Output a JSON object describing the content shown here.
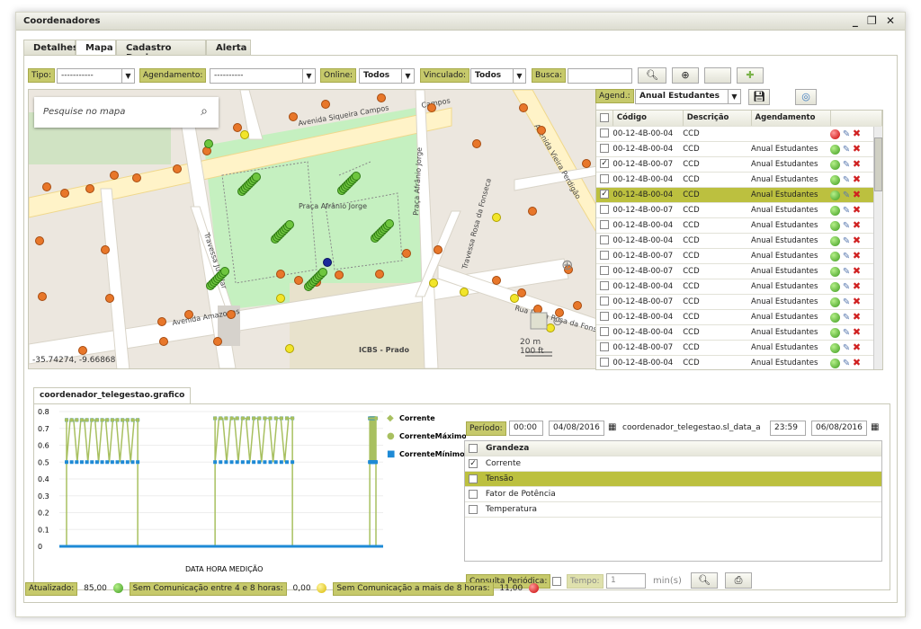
{
  "window": {
    "title": "Coordenadores",
    "controls": "_ ❐ ✕"
  },
  "tabs": [
    "Detalhes",
    "Mapa",
    "Cadastro Devices",
    "Alerta"
  ],
  "filters": {
    "tipo_label": "Tipo:",
    "tipo_value": "-----------",
    "agendamento_label": "Agendamento:",
    "agendamento_value": "----------",
    "online_label": "Online:",
    "online_value": "Todos",
    "vinculado_label": "Vinculado:",
    "vinculado_value": "Todos",
    "busca_label": "Busca:",
    "busca_value": ""
  },
  "map": {
    "search_placeholder": "Pesquise no mapa",
    "coords": "-35.74274, -9.66868",
    "scale_m": "20 m",
    "scale_ft": "100 ft",
    "labels": {
      "av_siqueira": "Avenida Siqueira Campos",
      "campos": "Campos",
      "av_amazonas": "Avenida Amazonas",
      "praca": "Praça Afrânio Jorge",
      "praca_street": "Praça Afrânio Jorge",
      "trav_rosa": "Travessa Rosa da Fonseca",
      "rua_dona": "Rua Dona Rosa da Fonseca",
      "trav_lubalar": "Travessa Jubalar",
      "icbs": "ICBS - Prado",
      "av_vieira": "Avenida Vieira Perdigão"
    }
  },
  "grid": {
    "agend_label": "Agend.:",
    "agend_value": "Anual Estudantes",
    "headers": [
      "Código",
      "Descrição",
      "Agendamento"
    ],
    "rows": [
      {
        "code": "00-12-4B-00-04",
        "desc": "CCD",
        "agend": "",
        "checked": false,
        "status": "red"
      },
      {
        "code": "00-12-4B-00-04",
        "desc": "CCD",
        "agend": "Anual Estudantes",
        "checked": false,
        "status": "green"
      },
      {
        "code": "00-12-4B-00-07",
        "desc": "CCD",
        "agend": "Anual Estudantes",
        "checked": true,
        "status": "green"
      },
      {
        "code": "00-12-4B-00-04",
        "desc": "CCD",
        "agend": "Anual Estudantes",
        "checked": false,
        "status": "green"
      },
      {
        "code": "00-12-4B-00-04",
        "desc": "CCD",
        "agend": "Anual Estudantes",
        "checked": true,
        "status": "green",
        "selected": true
      },
      {
        "code": "00-12-4B-00-07",
        "desc": "CCD",
        "agend": "Anual Estudantes",
        "checked": false,
        "status": "green"
      },
      {
        "code": "00-12-4B-00-04",
        "desc": "CCD",
        "agend": "Anual Estudantes",
        "checked": false,
        "status": "green"
      },
      {
        "code": "00-12-4B-00-04",
        "desc": "CCD",
        "agend": "Anual Estudantes",
        "checked": false,
        "status": "green"
      },
      {
        "code": "00-12-4B-00-07",
        "desc": "CCD",
        "agend": "Anual Estudantes",
        "checked": false,
        "status": "green"
      },
      {
        "code": "00-12-4B-00-07",
        "desc": "CCD",
        "agend": "Anual Estudantes",
        "checked": false,
        "status": "green"
      },
      {
        "code": "00-12-4B-00-04",
        "desc": "CCD",
        "agend": "Anual Estudantes",
        "checked": false,
        "status": "green"
      },
      {
        "code": "00-12-4B-00-07",
        "desc": "CCD",
        "agend": "Anual Estudantes",
        "checked": false,
        "status": "green"
      },
      {
        "code": "00-12-4B-00-04",
        "desc": "CCD",
        "agend": "Anual Estudantes",
        "checked": false,
        "status": "green"
      },
      {
        "code": "00-12-4B-00-04",
        "desc": "CCD",
        "agend": "Anual Estudantes",
        "checked": false,
        "status": "green"
      },
      {
        "code": "00-12-4B-00-07",
        "desc": "CCD",
        "agend": "Anual Estudantes",
        "checked": false,
        "status": "green"
      },
      {
        "code": "00-12-4B-00-04",
        "desc": "CCD",
        "agend": "Anual Estudantes",
        "checked": false,
        "status": "green"
      }
    ]
  },
  "chart_tab": "coordenador_telegestao.grafico",
  "chart_data": {
    "type": "line",
    "xlabel": "DATA HORA MEDIÇÃO",
    "ylim": [
      0,
      0.8
    ],
    "yticks": [
      "0",
      "0.1",
      "0.2",
      "0.3",
      "0.4",
      "0.5",
      "0.6",
      "0.7",
      "0.8"
    ],
    "legend": [
      "Corrente",
      "CorrenteMáximo",
      "CorrenteMínimo"
    ],
    "legend_position": "right",
    "colors": {
      "corrente": "#a8c060",
      "maximo": "#a8c060",
      "minimo": "#1e8ad6"
    },
    "segments": [
      {
        "x0": 0.0,
        "x1": 0.23,
        "max": 0.75,
        "min": 0.5
      },
      {
        "x0": 0.48,
        "x1": 0.73,
        "max": 0.76,
        "min": 0.5
      },
      {
        "x0": 0.98,
        "x1": 1.0,
        "max": 0.76,
        "min": 0.5
      }
    ]
  },
  "periodo": {
    "label": "Período:",
    "start_time": "00:00",
    "start_date": "04/08/2016",
    "mid_text": "coordenador_telegestao.sl_data_a",
    "end_time": "23:59",
    "end_date": "06/08/2016"
  },
  "grandeza": {
    "header": "Grandeza",
    "rows": [
      {
        "label": "Corrente",
        "checked": true,
        "selected": false
      },
      {
        "label": "Tensão",
        "checked": false,
        "selected": true
      },
      {
        "label": "Fator de Potência",
        "checked": false,
        "selected": false
      },
      {
        "label": "Temperatura",
        "checked": false,
        "selected": false
      }
    ]
  },
  "consulta": {
    "label": "Consulta Periódica:",
    "tempo_label": "Tempo:",
    "tempo_value": "1",
    "unit": "min(s)"
  },
  "status": {
    "atualizado_label": "Atualizado:",
    "atualizado_value": "85,00",
    "sem4_label": "Sem Comunicação entre 4 e 8 horas:",
    "sem4_value": "0,00",
    "sem8_label": "Sem Comunicação a mais de 8 horas:",
    "sem8_value": "11,00"
  }
}
